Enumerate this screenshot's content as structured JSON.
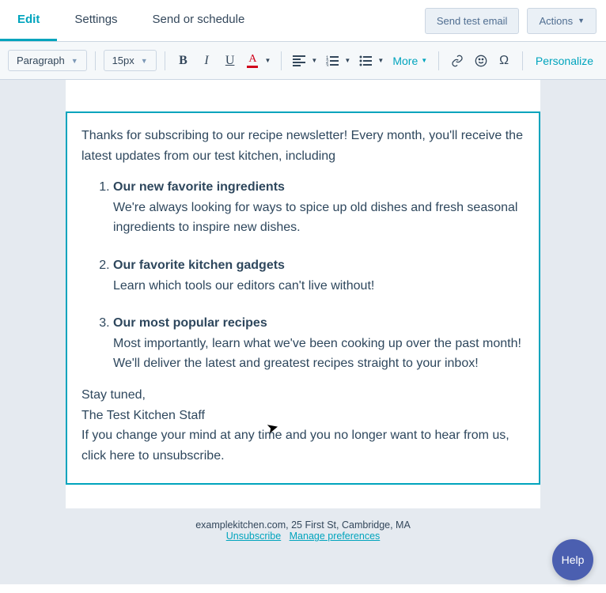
{
  "nav": {
    "tabs": [
      "Edit",
      "Settings",
      "Send or schedule"
    ],
    "send_test": "Send test email",
    "actions": "Actions"
  },
  "toolbar": {
    "block_type": "Paragraph",
    "font_size": "15px",
    "more": "More",
    "personalize": "Personalize"
  },
  "body": {
    "intro": "Thanks for subscribing to our recipe newsletter! Every month, you'll receive the latest updates from our test kitchen, including",
    "items": [
      {
        "title": "Our new favorite ingredients",
        "desc": "We're always looking for ways to spice up old dishes and fresh seasonal ingredients to inspire new dishes."
      },
      {
        "title": "Our favorite kitchen gadgets",
        "desc": "Learn which tools our editors can't live without!"
      },
      {
        "title": "Our most popular recipes",
        "desc": "Most importantly, learn what we've been cooking up over the past month! We'll deliver the latest and greatest recipes straight to your inbox!"
      }
    ],
    "sign1": "Stay tuned,",
    "sign2": "The Test Kitchen Staff",
    "unsub_note": "If you change your mind at any time and you no longer want to hear from us, click here to unsubscribe."
  },
  "footer": {
    "address": "examplekitchen.com, 25 First St, Cambridge, MA",
    "unsubscribe": "Unsubscribe",
    "manage": "Manage preferences"
  },
  "help": "Help"
}
